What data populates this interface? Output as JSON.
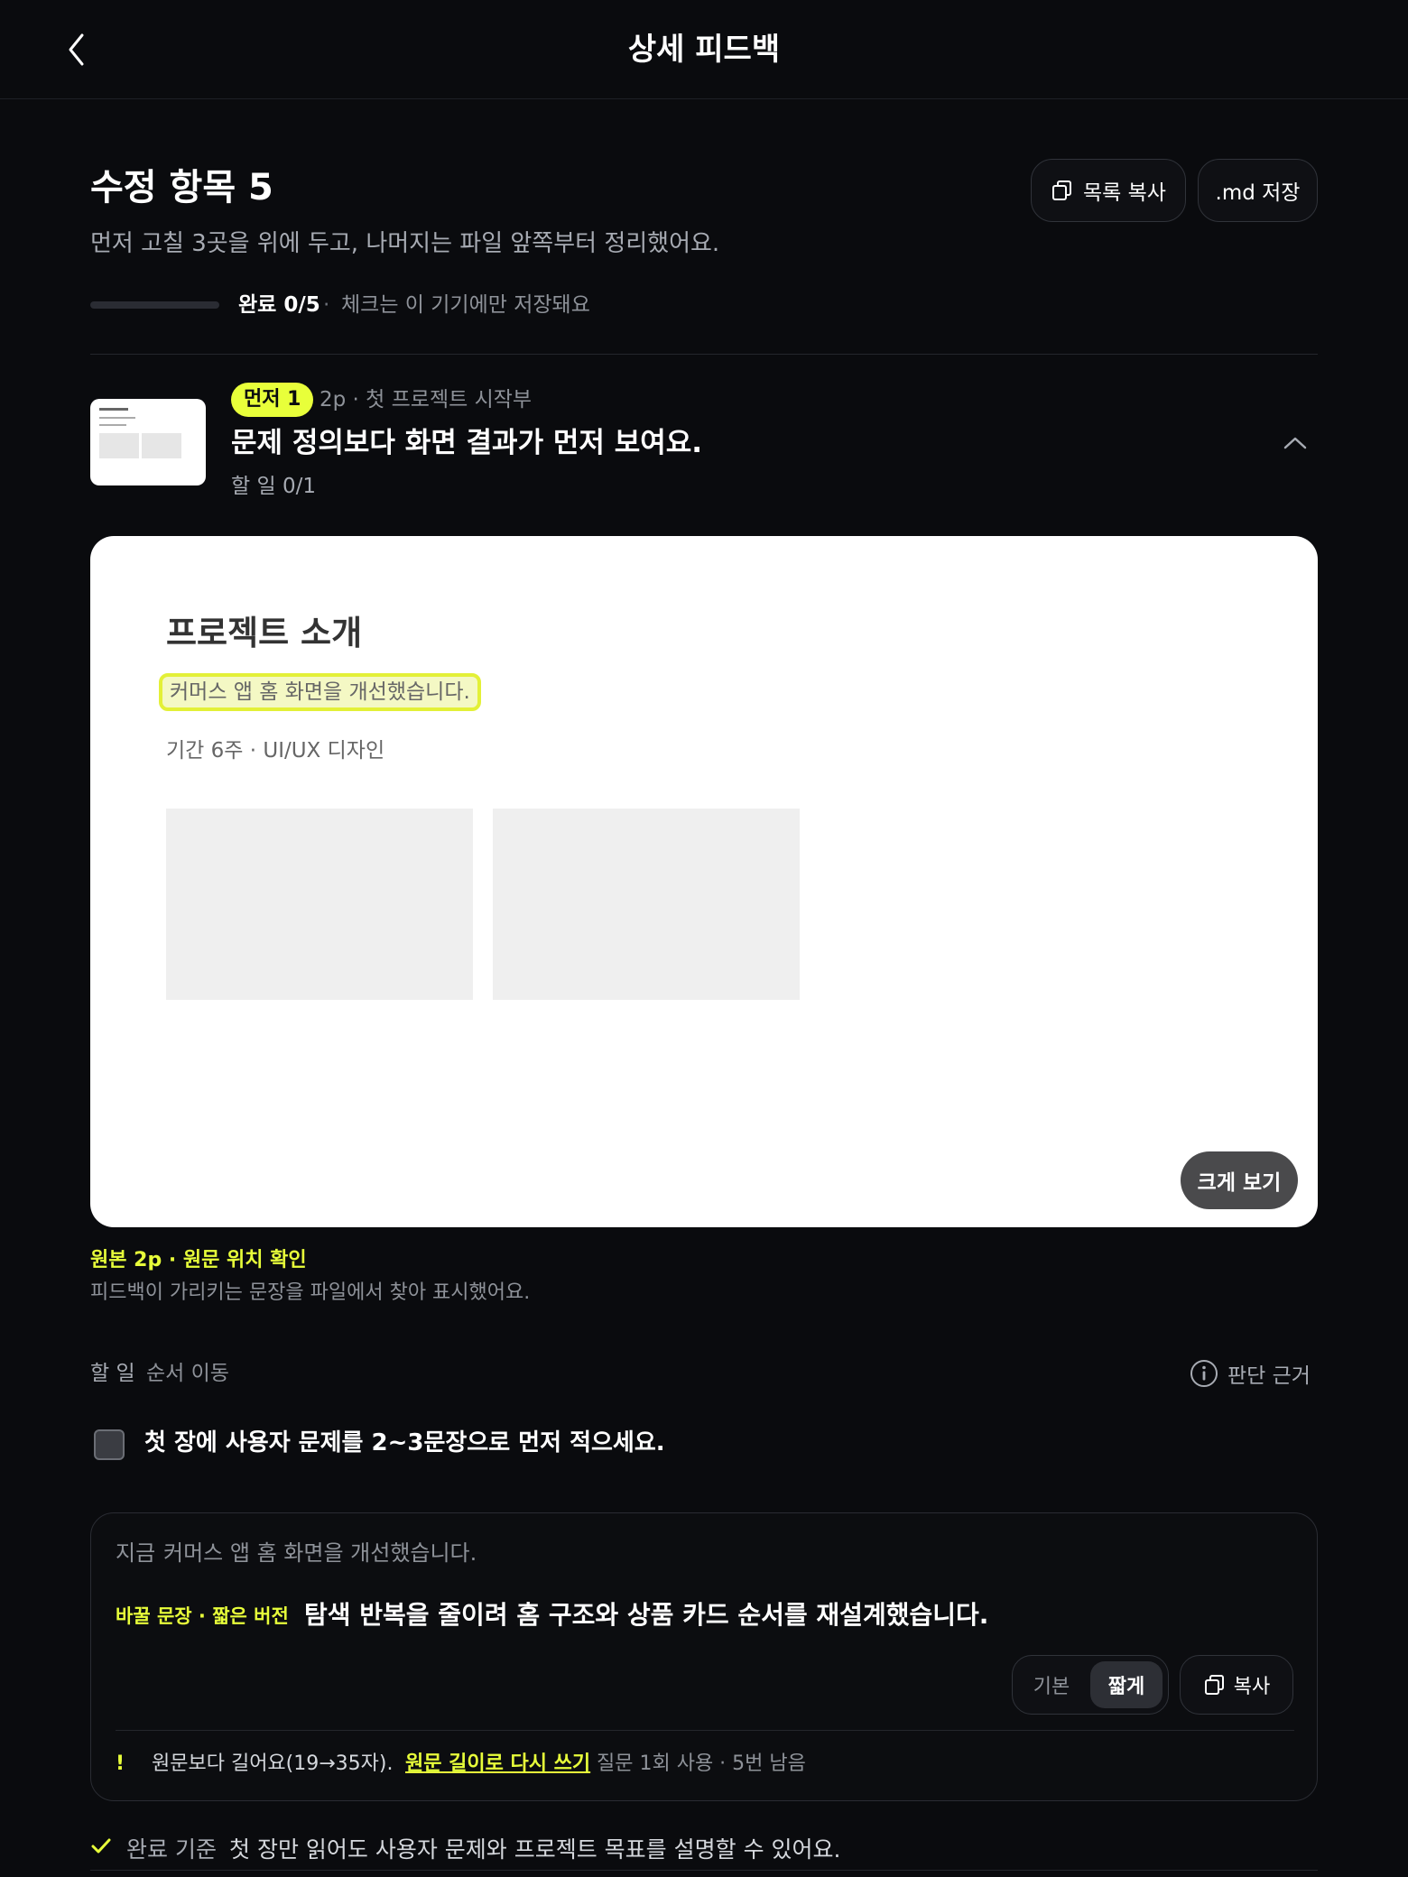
{
  "header": {
    "title": "상세 피드백"
  },
  "summary": {
    "title": "수정 항목 5",
    "subtitle": "먼저 고칠 3곳을 위에 두고, 나머지는 파일 앞쪽부터 정리했어요.",
    "copy_list_label": "목록 복사",
    "md_save_label": ".md 저장",
    "progress_fraction": 0,
    "progress_label": "완료 0/5",
    "progress_sep": "·",
    "progress_note": "체크는 이 기기에만 저장돼요"
  },
  "item": {
    "badge": "먼저 1",
    "meta": "2p · 첫 프로젝트 시작부",
    "title": "문제 정의보다 화면 결과가 먼저 보여요.",
    "todo_count": "할 일 0/1"
  },
  "preview": {
    "title": "프로젝트 소개",
    "highlighted": "커머스 앱 홈 화면을 개선했습니다.",
    "meta": "기간 6주 · UI/UX 디자인",
    "zoom_label": "크게 보기"
  },
  "source": {
    "title": "원본 2p · 원문 위치 확인",
    "subtitle": "피드백이 가리키는 문장을 파일에서 찾아 표시했어요."
  },
  "todo": {
    "label": "할 일",
    "reorder_label": "순서 이동",
    "basis_label": "판단 근거",
    "task": "첫 장에 사용자 문제를 2~3문장으로 먼저 적으세요.",
    "checked": false
  },
  "rewrite": {
    "now_label": "지금",
    "now_text": "커머스 앱 홈 화면을 개선했습니다.",
    "alt_label": "바꿀 문장 · 짧은 버전",
    "alt_text": "탐색 반복을 줄이려 홈 구조와 상품 카드 순서를 재설계했습니다.",
    "seg_basic": "기본",
    "seg_short": "짧게",
    "copy_label": "복사",
    "warn_mark": "!",
    "warn_text": "원문보다 길어요(19→35자).",
    "rewrite_link": "원문 길이로 다시 쓰기",
    "quota_text": "질문 1회 사용 · 5번 남음"
  },
  "criteria": {
    "label": "완료 기준",
    "text": "첫 장만 읽어도 사용자 문제와 프로젝트 목표를 설명할 수 있어요."
  },
  "colors": {
    "accent": "#e8ff3a",
    "background": "#0a0b0e"
  },
  "icons": [
    "chevron-left-icon",
    "copy-icon",
    "chevron-up-icon",
    "info-icon",
    "check-icon"
  ]
}
